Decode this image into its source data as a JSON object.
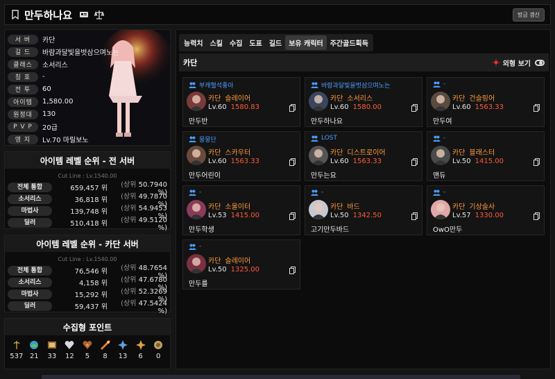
{
  "header": {
    "name": "만두하나요",
    "refresh_label": "방금 갱신"
  },
  "profile": {
    "rows": [
      {
        "label": "서 버",
        "value": "카단"
      },
      {
        "label": "길 드",
        "value": "바람과달빛을벗삼으며노는"
      },
      {
        "label": "클래스",
        "value": "소서리스"
      },
      {
        "label": "칭 호",
        "value": "-"
      },
      {
        "label": "전 투",
        "value": "60"
      },
      {
        "label": "아이템",
        "value": "1,580.00"
      },
      {
        "label": "원정대",
        "value": "130"
      },
      {
        "label": "P V P",
        "value": "20급"
      },
      {
        "label": "영 지",
        "value": "Lv.70 마릴보노"
      }
    ]
  },
  "rank_all": {
    "title": "아이템 레벨 순위 - 전 서버",
    "cutline": "Cut Line : Lv.1540.00",
    "rows": [
      {
        "label": "전체 통합",
        "pos": "659,457 위",
        "top": "(상위",
        "pct": "50.7940 %)"
      },
      {
        "label": "소서리스",
        "pos": "36,818 위",
        "top": "(상위",
        "pct": "49.7870 %)"
      },
      {
        "label": "마법사",
        "pos": "139,748 위",
        "top": "(상위",
        "pct": "54.9453 %)"
      },
      {
        "label": "딜러",
        "pos": "510,418 위",
        "top": "(상위",
        "pct": "49.5120 %)"
      }
    ]
  },
  "rank_server": {
    "title": "아이템 레벨 순위 - 카단 서버",
    "cutline": "Cut Line : Lv.1540.00",
    "rows": [
      {
        "label": "전체 통합",
        "pos": "76,546 위",
        "top": "(상위",
        "pct": "48.7654 %)"
      },
      {
        "label": "소서리스",
        "pos": "4,158 위",
        "top": "(상위",
        "pct": "47.6780 %)"
      },
      {
        "label": "마법사",
        "pos": "15,292 위",
        "top": "(상위",
        "pct": "52.3269 %)"
      },
      {
        "label": "딜러",
        "pos": "59,437 위",
        "top": "(상위",
        "pct": "47.5424 %)"
      }
    ]
  },
  "collect": {
    "title": "수집형 포인트",
    "items": [
      {
        "icon": "seed-icon",
        "count": "537"
      },
      {
        "icon": "island-icon",
        "count": "21"
      },
      {
        "icon": "painting-icon",
        "count": "33"
      },
      {
        "icon": "heart-icon",
        "count": "12"
      },
      {
        "icon": "giant-heart-icon",
        "count": "5"
      },
      {
        "icon": "cosmos-icon",
        "count": "8"
      },
      {
        "icon": "leaf-icon",
        "count": "13"
      },
      {
        "icon": "star-icon",
        "count": "6"
      },
      {
        "icon": "medal-icon",
        "count": "0"
      }
    ]
  },
  "tabs": [
    "능력치",
    "스킬",
    "수집",
    "도표",
    "길드",
    "보유 캐릭터",
    "주간골드획득"
  ],
  "server_bar": {
    "server": "카단",
    "appearance_label": "외형 보기"
  },
  "characters": [
    {
      "guild": "부캐혈석좋아",
      "server": "카단",
      "job": "슬레이어",
      "level": "Lv.60",
      "item": "1580.83",
      "name": "만두반",
      "col": 0,
      "row": 0,
      "avatar": "#7a3a3a"
    },
    {
      "guild": "바람과달빛을벗삼으며노는",
      "server": "카단",
      "job": "소서리스",
      "level": "Lv.60",
      "item": "1580.00",
      "name": "만두하나요",
      "col": 1,
      "row": 0,
      "avatar": "#3a4660"
    },
    {
      "guild": "-",
      "server": "카단",
      "job": "건슬링어",
      "level": "Lv.60",
      "item": "1563.33",
      "name": "만두여",
      "col": 2,
      "row": 0,
      "avatar": "#5a4a40"
    },
    {
      "guild": "뭉뭉단",
      "server": "카단",
      "job": "스카우터",
      "level": "Lv.60",
      "item": "1563.33",
      "name": "만두어린이",
      "col": 0,
      "row": 1,
      "avatar": "#6a4a3a"
    },
    {
      "guild": "LOST",
      "server": "카단",
      "job": "디스트로이어",
      "level": "Lv.60",
      "item": "1563.33",
      "name": "만두는요",
      "col": 1,
      "row": 1,
      "avatar": "#555555"
    },
    {
      "guild": "-",
      "server": "카단",
      "job": "블래스터",
      "level": "Lv.50",
      "item": "1415.00",
      "name": "맨듀",
      "col": 2,
      "row": 1,
      "avatar": "#4a4a4a"
    },
    {
      "guild": "-",
      "server": "카단",
      "job": "소울이터",
      "level": "Lv.53",
      "item": "1415.00",
      "name": "만두학생",
      "col": 0,
      "row": 2,
      "avatar": "#8a3a5a"
    },
    {
      "guild": "-",
      "server": "카단",
      "job": "바드",
      "level": "Lv.50",
      "item": "1342.50",
      "name": "고기만두바드",
      "col": 1,
      "row": 2,
      "avatar": "#c8c8d0"
    },
    {
      "guild": "-",
      "server": "카단",
      "job": "기상술사",
      "level": "Lv.57",
      "item": "1330.00",
      "name": "OwO만두",
      "col": 2,
      "row": 2,
      "avatar": "#e0a8a8"
    },
    {
      "guild": "-",
      "server": "카단",
      "job": "슬레이어",
      "level": "Lv.50",
      "item": "1325.00",
      "name": "만두를",
      "col": 0,
      "row": 3,
      "avatar": "#7a3040"
    }
  ]
}
